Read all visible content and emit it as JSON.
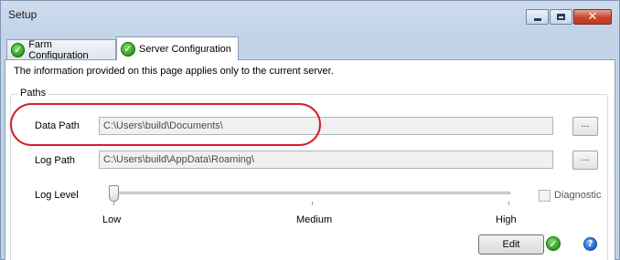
{
  "window": {
    "title": "Setup",
    "minimize_icon": "minimize-icon",
    "maximize_icon": "maximize-icon",
    "close_icon": "close-icon",
    "close_glyph": "✕"
  },
  "tabs": [
    {
      "label": "Farm Configuration",
      "icon": "check-icon",
      "active": false
    },
    {
      "label": "Server Configuration",
      "icon": "check-icon",
      "active": true
    }
  ],
  "check_glyph": "✓",
  "info_text": "The information provided on this page applies only to the current server.",
  "paths": {
    "legend": "Paths",
    "data_path": {
      "label": "Data Path",
      "value": "C:\\Users\\build\\Documents\\",
      "browse_label": "..."
    },
    "log_path": {
      "label": "Log Path",
      "value": "C:\\Users\\build\\AppData\\Roaming\\",
      "browse_label": "..."
    },
    "log_level": {
      "label": "Log Level",
      "levels": [
        "Low",
        "Medium",
        "High"
      ],
      "selected": "Low"
    },
    "diagnostic": {
      "label": "Diagnostic",
      "checked": false
    }
  },
  "actions": {
    "edit_label": "Edit",
    "help_glyph": "?"
  },
  "colors": {
    "highlight": "#d01f2b",
    "accent_green": "#2b9a1e"
  }
}
